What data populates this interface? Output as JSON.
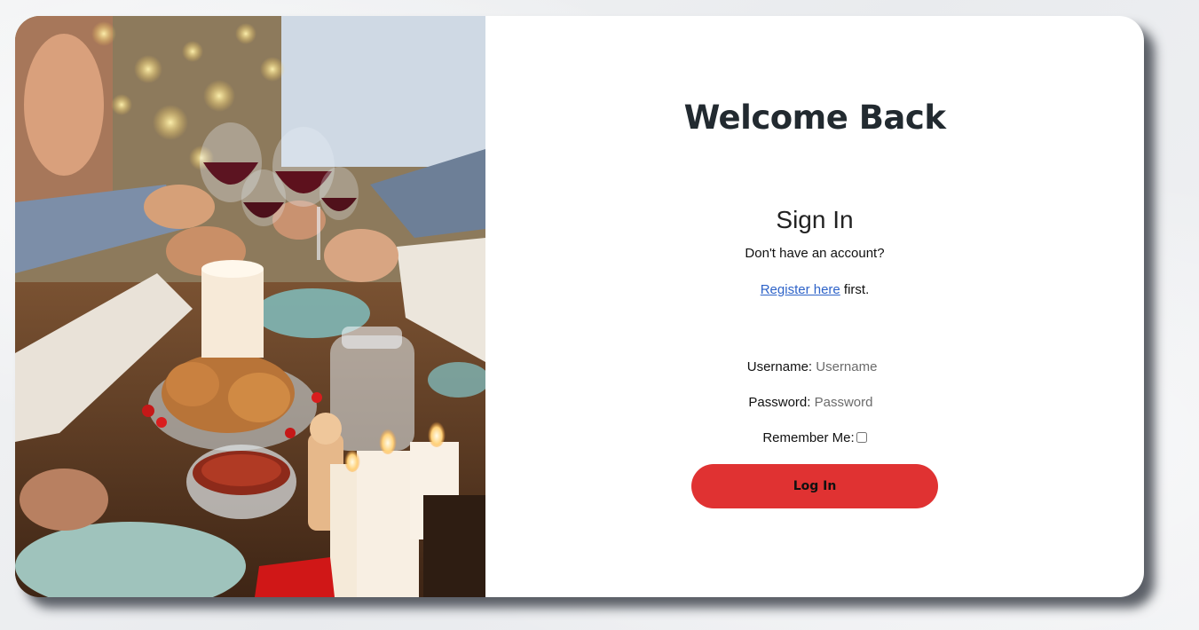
{
  "page": {
    "welcome_title": "Welcome Back",
    "sign_in_heading": "Sign In",
    "no_account_text": "Don't have an account?",
    "register_link_label": "Register here",
    "register_suffix": " first."
  },
  "form": {
    "username_label": "Username:",
    "username_placeholder": "Username",
    "password_label": "Password:",
    "password_placeholder": "Password",
    "remember_label": "Remember Me:",
    "remember_checked": false,
    "login_button_label": "Log In"
  },
  "colors": {
    "login_button": "#e03232",
    "link": "#2e63c8",
    "heading": "#222a30"
  }
}
